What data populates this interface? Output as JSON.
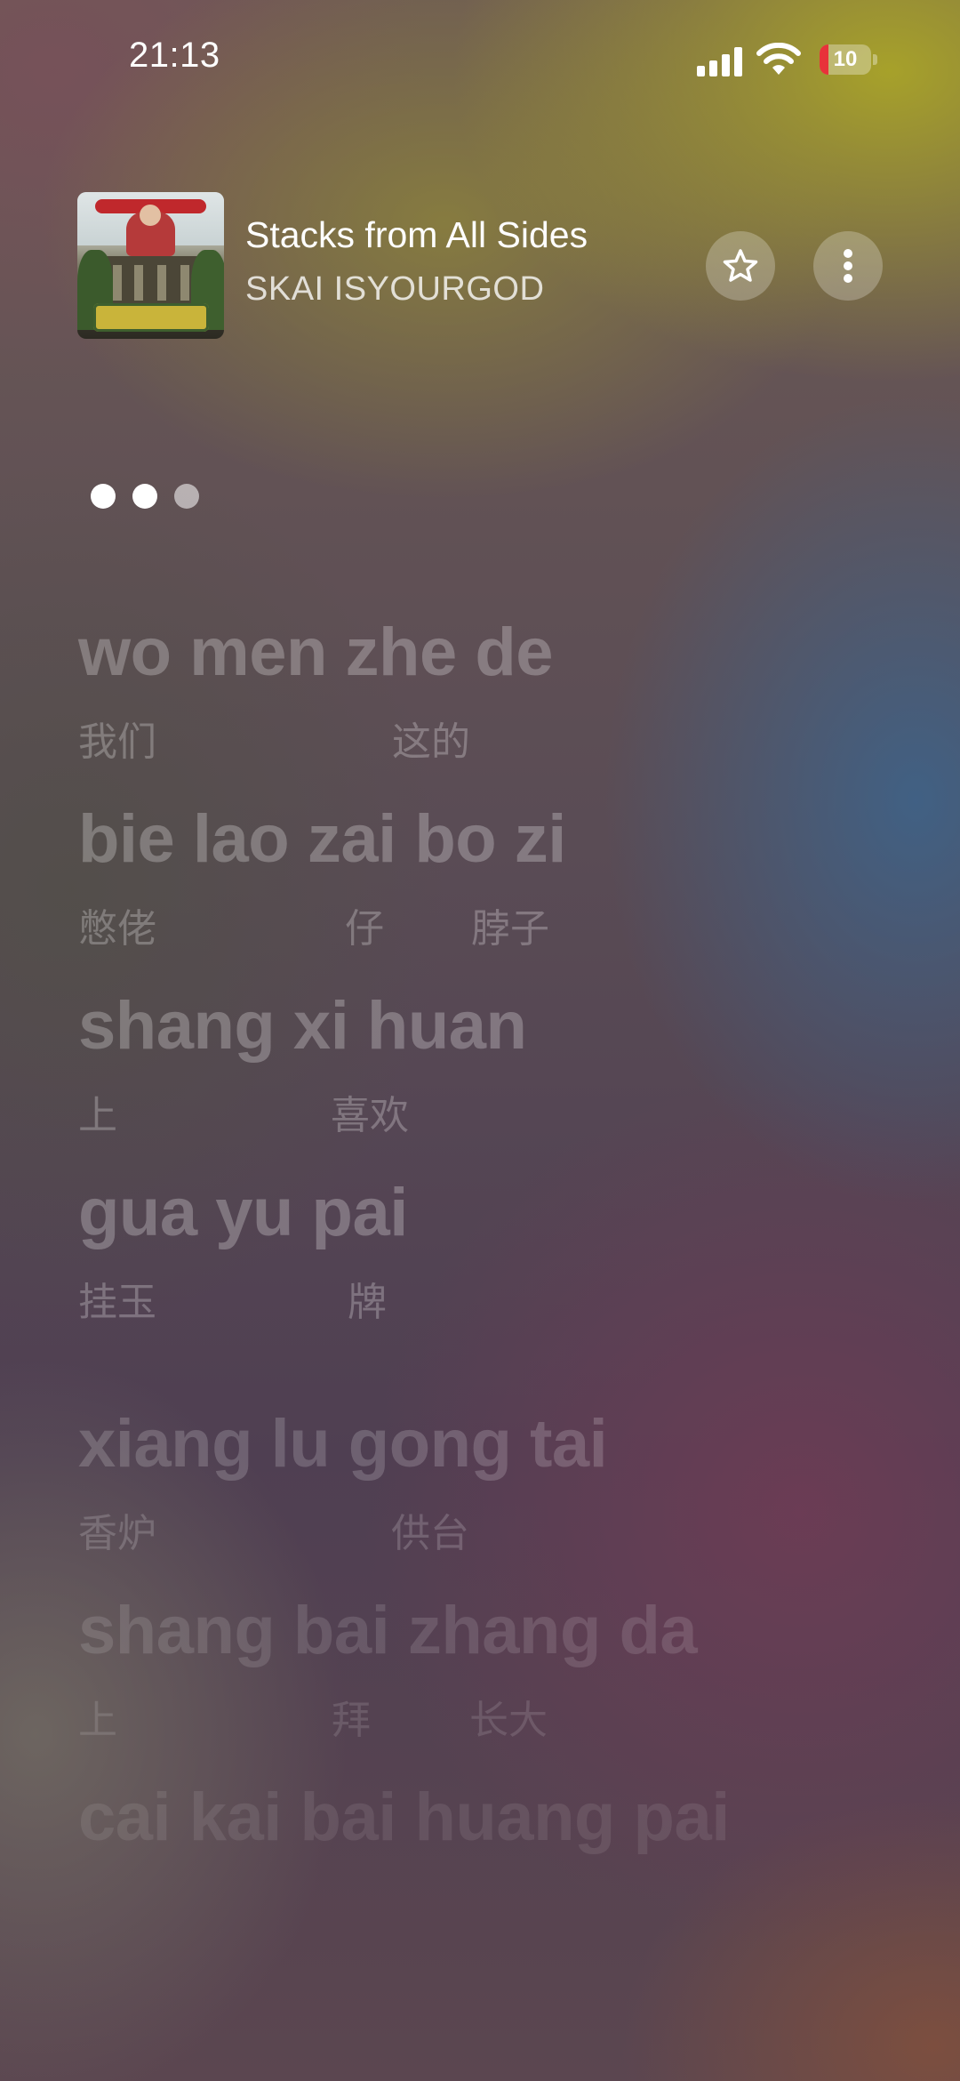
{
  "status_bar": {
    "time": "21:13",
    "battery_level": "10",
    "battery_color": "#e8323a",
    "icons": [
      "signal-icon",
      "wifi-icon",
      "battery-icon"
    ]
  },
  "now_playing": {
    "title": "Stacks from All Sides",
    "artist": "SKAI ISYOURGOD",
    "artwork": "album-artwork",
    "actions": [
      "star-icon",
      "more-vertical-icon"
    ]
  },
  "lyrics": {
    "progress_dots": 3,
    "lines": [
      {
        "pinyin": "wo men zhe de",
        "hanzi": [
          {
            "text": "我们"
          },
          {
            "text": "这的"
          }
        ]
      },
      {
        "pinyin": "bie lao zai bo zi",
        "hanzi": [
          {
            "text": "憋佬"
          },
          {
            "text": "仔"
          },
          {
            "text": "脖子"
          }
        ]
      },
      {
        "pinyin": "shang xi huan",
        "hanzi": [
          {
            "text": "上"
          },
          {
            "text": "喜欢"
          }
        ]
      },
      {
        "pinyin": "gua yu pai",
        "hanzi": [
          {
            "text": "挂玉"
          },
          {
            "text": "牌"
          }
        ]
      },
      {
        "pinyin": "xiang lu gong tai",
        "hanzi": [
          {
            "text": "香炉"
          },
          {
            "text": "供台"
          }
        ]
      },
      {
        "pinyin": "shang bai zhang da",
        "hanzi": [
          {
            "text": "上"
          },
          {
            "text": "拜"
          },
          {
            "text": "长大"
          }
        ]
      },
      {
        "pinyin": "cai kai bai huang pai",
        "hanzi": [
          {
            "text": ""
          }
        ]
      }
    ]
  }
}
